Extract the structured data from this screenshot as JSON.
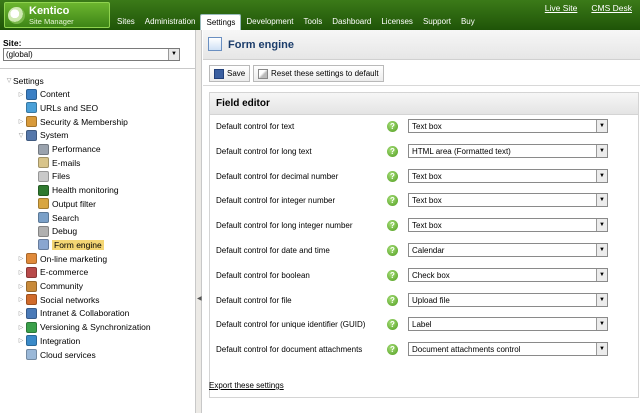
{
  "header": {
    "logo_title": "Kentico",
    "logo_subtitle": "Site Manager",
    "nav": [
      "Sites",
      "Administration",
      "Settings",
      "Development",
      "Tools",
      "Dashboard",
      "Licenses",
      "Support",
      "Buy"
    ],
    "active_nav": "Settings",
    "links": [
      "Live Site",
      "CMS Desk"
    ]
  },
  "site": {
    "label": "Site:",
    "selected": "(global)"
  },
  "tree": [
    {
      "label": "Settings",
      "level": 0,
      "expander": "▽",
      "icon": "settings-icon",
      "color": "#ffffff"
    },
    {
      "label": "Content",
      "level": 1,
      "expander": "▷",
      "icon": "globe-icon",
      "color": "#3a7fc4"
    },
    {
      "label": "URLs and SEO",
      "level": 1,
      "expander": "",
      "icon": "globe-link-icon",
      "color": "#4aa0d8"
    },
    {
      "label": "Security & Membership",
      "level": 1,
      "expander": "▷",
      "icon": "users-icon",
      "color": "#d89a3a"
    },
    {
      "label": "System",
      "level": 1,
      "expander": "▽",
      "icon": "computer-icon",
      "color": "#5577aa"
    },
    {
      "label": "Performance",
      "level": 2,
      "expander": "",
      "icon": "gauge-icon",
      "color": "#9aa2ad"
    },
    {
      "label": "E-mails",
      "level": 2,
      "expander": "",
      "icon": "envelope-icon",
      "color": "#d8c48a"
    },
    {
      "label": "Files",
      "level": 2,
      "expander": "",
      "icon": "file-icon",
      "color": "#c9c9c9"
    },
    {
      "label": "Health monitoring",
      "level": 2,
      "expander": "",
      "icon": "monitor-icon",
      "color": "#2f7a2f"
    },
    {
      "label": "Output filter",
      "level": 2,
      "expander": "",
      "icon": "filter-icon",
      "color": "#d8a640"
    },
    {
      "label": "Search",
      "level": 2,
      "expander": "",
      "icon": "search-icon",
      "color": "#7aa0c8"
    },
    {
      "label": "Debug",
      "level": 2,
      "expander": "",
      "icon": "debug-icon",
      "color": "#b0b0b0"
    },
    {
      "label": "Form engine",
      "level": 2,
      "expander": "",
      "icon": "form-icon",
      "color": "#8aa6d0",
      "selected": true
    },
    {
      "label": "On-line marketing",
      "level": 1,
      "expander": "▷",
      "icon": "marketing-icon",
      "color": "#e08a3a"
    },
    {
      "label": "E-commerce",
      "level": 1,
      "expander": "▷",
      "icon": "cart-icon",
      "color": "#b84a4a"
    },
    {
      "label": "Community",
      "level": 1,
      "expander": "▷",
      "icon": "community-icon",
      "color": "#c88a3a"
    },
    {
      "label": "Social networks",
      "level": 1,
      "expander": "▷",
      "icon": "social-icon",
      "color": "#d06a2a"
    },
    {
      "label": "Intranet & Collaboration",
      "level": 1,
      "expander": "▷",
      "icon": "intranet-icon",
      "color": "#4a7ab8"
    },
    {
      "label": "Versioning & Synchronization",
      "level": 1,
      "expander": "▷",
      "icon": "sync-icon",
      "color": "#3aa04a"
    },
    {
      "label": "Integration",
      "level": 1,
      "expander": "▷",
      "icon": "integration-icon",
      "color": "#3a8ac8"
    },
    {
      "label": "Cloud services",
      "level": 1,
      "expander": "",
      "icon": "cloud-icon",
      "color": "#9ab8d8"
    }
  ],
  "page": {
    "title": "Form engine",
    "save_label": "Save",
    "reset_label": "Reset these settings to default",
    "panel_title": "Field editor",
    "export_label": "Export these settings"
  },
  "fields": [
    {
      "label": "Default control for text",
      "value": "Text box"
    },
    {
      "label": "Default control for long text",
      "value": "HTML area (Formatted text)"
    },
    {
      "label": "Default control for decimal number",
      "value": "Text box"
    },
    {
      "label": "Default control for integer number",
      "value": "Text box"
    },
    {
      "label": "Default control for long integer number",
      "value": "Text box"
    },
    {
      "label": "Default control for date and time",
      "value": "Calendar"
    },
    {
      "label": "Default control for boolean",
      "value": "Check box"
    },
    {
      "label": "Default control for file",
      "value": "Upload file"
    },
    {
      "label": "Default control for unique identifier (GUID)",
      "value": "Label"
    },
    {
      "label": "Default control for document attachments",
      "value": "Document attachments control"
    }
  ]
}
